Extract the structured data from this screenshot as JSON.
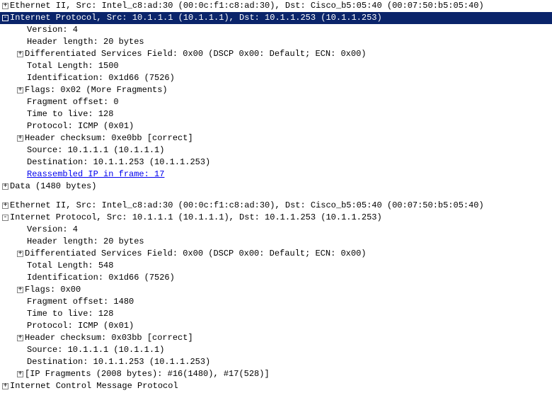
{
  "packet1": {
    "ethernet": "Ethernet II, Src: Intel_c8:ad:30 (00:0c:f1:c8:ad:30), Dst: Cisco_b5:05:40 (00:07:50:b5:05:40)",
    "ip_header": "Internet Protocol, Src: 10.1.1.1 (10.1.1.1), Dst: 10.1.1.253 (10.1.1.253)",
    "version": "Version: 4",
    "header_length": "Header length: 20 bytes",
    "dsf": "Differentiated Services Field: 0x00 (DSCP 0x00: Default; ECN: 0x00)",
    "total_length": "Total Length: 1500",
    "identification": "Identification: 0x1d66 (7526)",
    "flags": "Flags: 0x02 (More Fragments)",
    "fragment_offset": "Fragment offset: 0",
    "ttl": "Time to live: 128",
    "protocol": "Protocol: ICMP (0x01)",
    "checksum": "Header checksum: 0xe0bb [correct]",
    "source": "Source: 10.1.1.1 (10.1.1.1)",
    "destination": "Destination: 10.1.1.253 (10.1.1.253)",
    "reassembled": "Reassembled IP in frame: 17",
    "data": "Data (1480 bytes)"
  },
  "packet2": {
    "ethernet": "Ethernet II, Src: Intel_c8:ad:30 (00:0c:f1:c8:ad:30), Dst: Cisco_b5:05:40 (00:07:50:b5:05:40)",
    "ip_header": "Internet Protocol, Src: 10.1.1.1 (10.1.1.1), Dst: 10.1.1.253 (10.1.1.253)",
    "version": "Version: 4",
    "header_length": "Header length: 20 bytes",
    "dsf": "Differentiated Services Field: 0x00 (DSCP 0x00: Default; ECN: 0x00)",
    "total_length": "Total Length: 548",
    "identification": "Identification: 0x1d66 (7526)",
    "flags": "Flags: 0x00",
    "fragment_offset": "Fragment offset: 1480",
    "ttl": "Time to live: 128",
    "protocol": "Protocol: ICMP (0x01)",
    "checksum": "Header checksum: 0x03bb [correct]",
    "source": "Source: 10.1.1.1 (10.1.1.1)",
    "destination": "Destination: 10.1.1.253 (10.1.1.253)",
    "fragments": "[IP Fragments (2008 bytes): #16(1480), #17(528)]",
    "icmp": "Internet Control Message Protocol"
  },
  "glyph": {
    "plus": "+",
    "minus": "-"
  }
}
